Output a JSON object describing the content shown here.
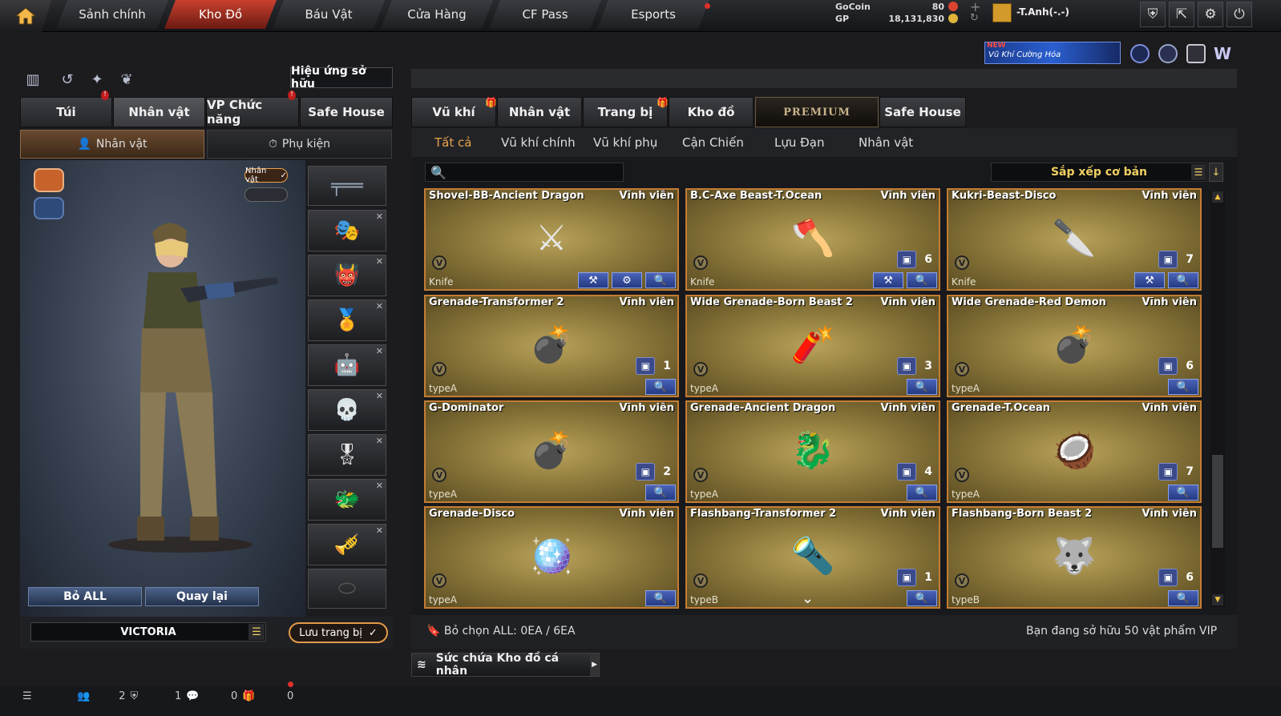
{
  "topnav": {
    "tabs": [
      "Sảnh chính",
      "Kho Đồ",
      "Báu Vật",
      "Cửa Hàng",
      "CF Pass",
      "Esports"
    ],
    "active_index": 1
  },
  "currency": {
    "gocoin_label": "GoCoin",
    "gocoin_value": "80",
    "gp_label": "GP",
    "gp_value": "18,131,830"
  },
  "user": {
    "name": "-T.Anh(-.-)"
  },
  "banner": {
    "new_tag": "NEW",
    "text": "Vũ Khí Cường Hóa"
  },
  "left": {
    "effect_button": "Hiệu ứng sở hữu",
    "tabs": [
      "Túi",
      "Nhân vật",
      "VP Chức năng",
      "Safe House"
    ],
    "active_tab": 1,
    "subtabs": [
      "Nhân vật",
      "Phụ kiện"
    ],
    "char_badge": "Nhân vật",
    "remove_all": "Bỏ ALL",
    "back": "Quay lại",
    "char_name": "VICTORIA",
    "save": "Lưu trang bị"
  },
  "right": {
    "tabs": [
      "Vũ khí",
      "Nhân vật",
      "Trang bị",
      "Kho đồ",
      "PREMIUM",
      "Safe House"
    ],
    "active_tab": 4,
    "filters": [
      "Tất cả",
      "Vũ khí chính",
      "Vũ khí phụ",
      "Cận Chiến",
      "Lựu Đạn",
      "Nhân vật"
    ],
    "active_filter": 0,
    "search_placeholder": "",
    "sort_label": "Sắp xếp cơ bản",
    "items": [
      {
        "name": "Shovel-BB-Ancient Dragon",
        "perm": "Vĩnh viễn",
        "type": "Knife",
        "count": "",
        "icon": "⚔"
      },
      {
        "name": "B.C-Axe Beast-T.Ocean",
        "perm": "Vĩnh viễn",
        "type": "Knife",
        "count": "6",
        "icon": "🪓"
      },
      {
        "name": "Kukri-Beast-Disco",
        "perm": "Vĩnh viễn",
        "type": "Knife",
        "count": "7",
        "icon": "🔪"
      },
      {
        "name": "Grenade-Transformer 2",
        "perm": "Vĩnh viễn",
        "type": "typeA",
        "count": "1",
        "icon": "💣"
      },
      {
        "name": "Wide Grenade-Born Beast 2",
        "perm": "Vĩnh viễn",
        "type": "typeA",
        "count": "3",
        "icon": "🧨"
      },
      {
        "name": "Wide Grenade-Red Demon",
        "perm": "Vĩnh viễn",
        "type": "typeA",
        "count": "6",
        "icon": "💣"
      },
      {
        "name": "G-Dominator",
        "perm": "Vĩnh viễn",
        "type": "typeA",
        "count": "2",
        "icon": "💣"
      },
      {
        "name": "Grenade-Ancient Dragon",
        "perm": "Vĩnh viễn",
        "type": "typeA",
        "count": "4",
        "icon": "🐉"
      },
      {
        "name": "Grenade-T.Ocean",
        "perm": "Vĩnh viễn",
        "type": "typeA",
        "count": "7",
        "icon": "🥥"
      },
      {
        "name": "Grenade-Disco",
        "perm": "Vĩnh viễn",
        "type": "typeA",
        "count": "",
        "icon": "🪩"
      },
      {
        "name": "Flashbang-Transformer 2",
        "perm": "Vĩnh viễn",
        "type": "typeB",
        "count": "1",
        "icon": "🔦"
      },
      {
        "name": "Flashbang-Born Beast 2",
        "perm": "Vĩnh viễn",
        "type": "typeB",
        "count": "6",
        "icon": "🐺"
      }
    ],
    "status_left": "Bỏ chọn ALL: 0EA / 6EA",
    "status_right": "Bạn đang sở hữu 50 vật phẩm VIP",
    "capacity": "Sức chứa Kho đồ cá nhân"
  },
  "footer": {
    "friends": "2",
    "clan": "1",
    "chat": "0",
    "gift": "0"
  },
  "icons": {
    "home": "home-icon",
    "settings": "gear-icon",
    "power": "power-icon",
    "search": "search-icon"
  },
  "colors": {
    "accent": "#e9a24c",
    "active_tab": "#c9412e",
    "card_border": "#c47d34",
    "button_blue": "#3b54a8"
  }
}
